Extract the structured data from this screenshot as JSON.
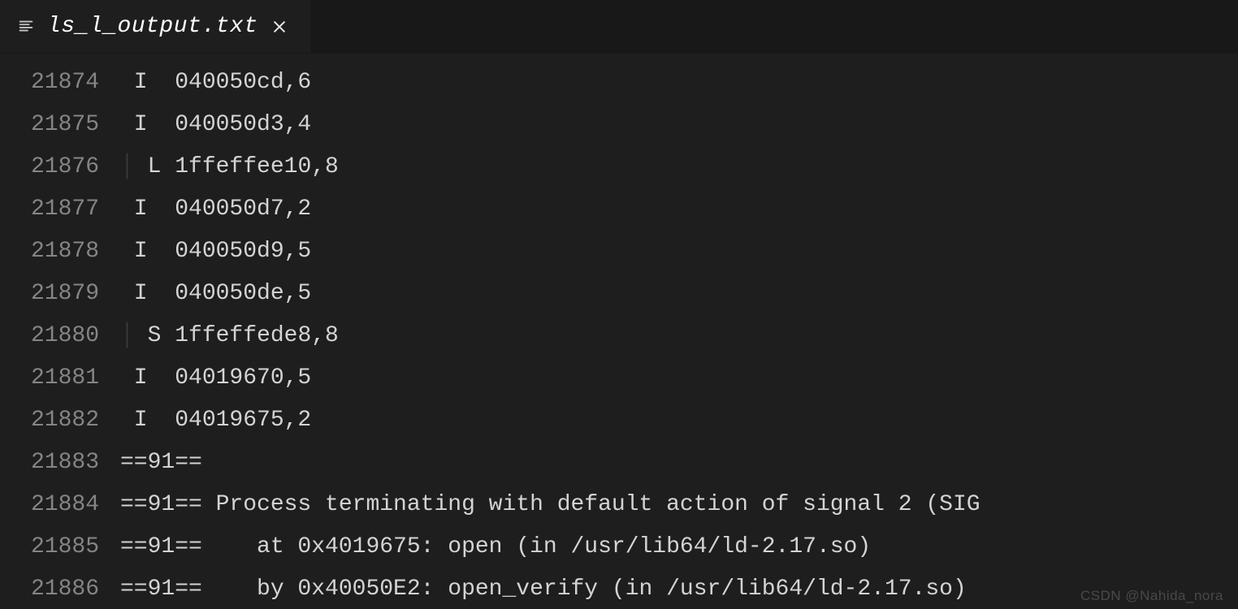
{
  "tab": {
    "filename": "ls_l_output.txt"
  },
  "lines": [
    {
      "num": "21874",
      "text": "I  040050cd,6"
    },
    {
      "num": "21875",
      "text": "I  040050d3,4"
    },
    {
      "num": "21876",
      "text": " L 1ffeffee10,8",
      "guided": true
    },
    {
      "num": "21877",
      "text": "I  040050d7,2"
    },
    {
      "num": "21878",
      "text": "I  040050d9,5"
    },
    {
      "num": "21879",
      "text": "I  040050de,5"
    },
    {
      "num": "21880",
      "text": " S 1ffeffede8,8",
      "guided": true
    },
    {
      "num": "21881",
      "text": "I  04019670,5"
    },
    {
      "num": "21882",
      "text": "I  04019675,2"
    },
    {
      "num": "21883",
      "text": "==91== "
    },
    {
      "num": "21884",
      "text": "==91== Process terminating with default action of signal 2 (SIG"
    },
    {
      "num": "21885",
      "text": "==91==    at 0x4019675: open (in /usr/lib64/ld-2.17.so)"
    },
    {
      "num": "21886",
      "text": "==91==    by 0x40050E2: open_verify (in /usr/lib64/ld-2.17.so)"
    }
  ],
  "watermark": "CSDN @Nahida_nora"
}
